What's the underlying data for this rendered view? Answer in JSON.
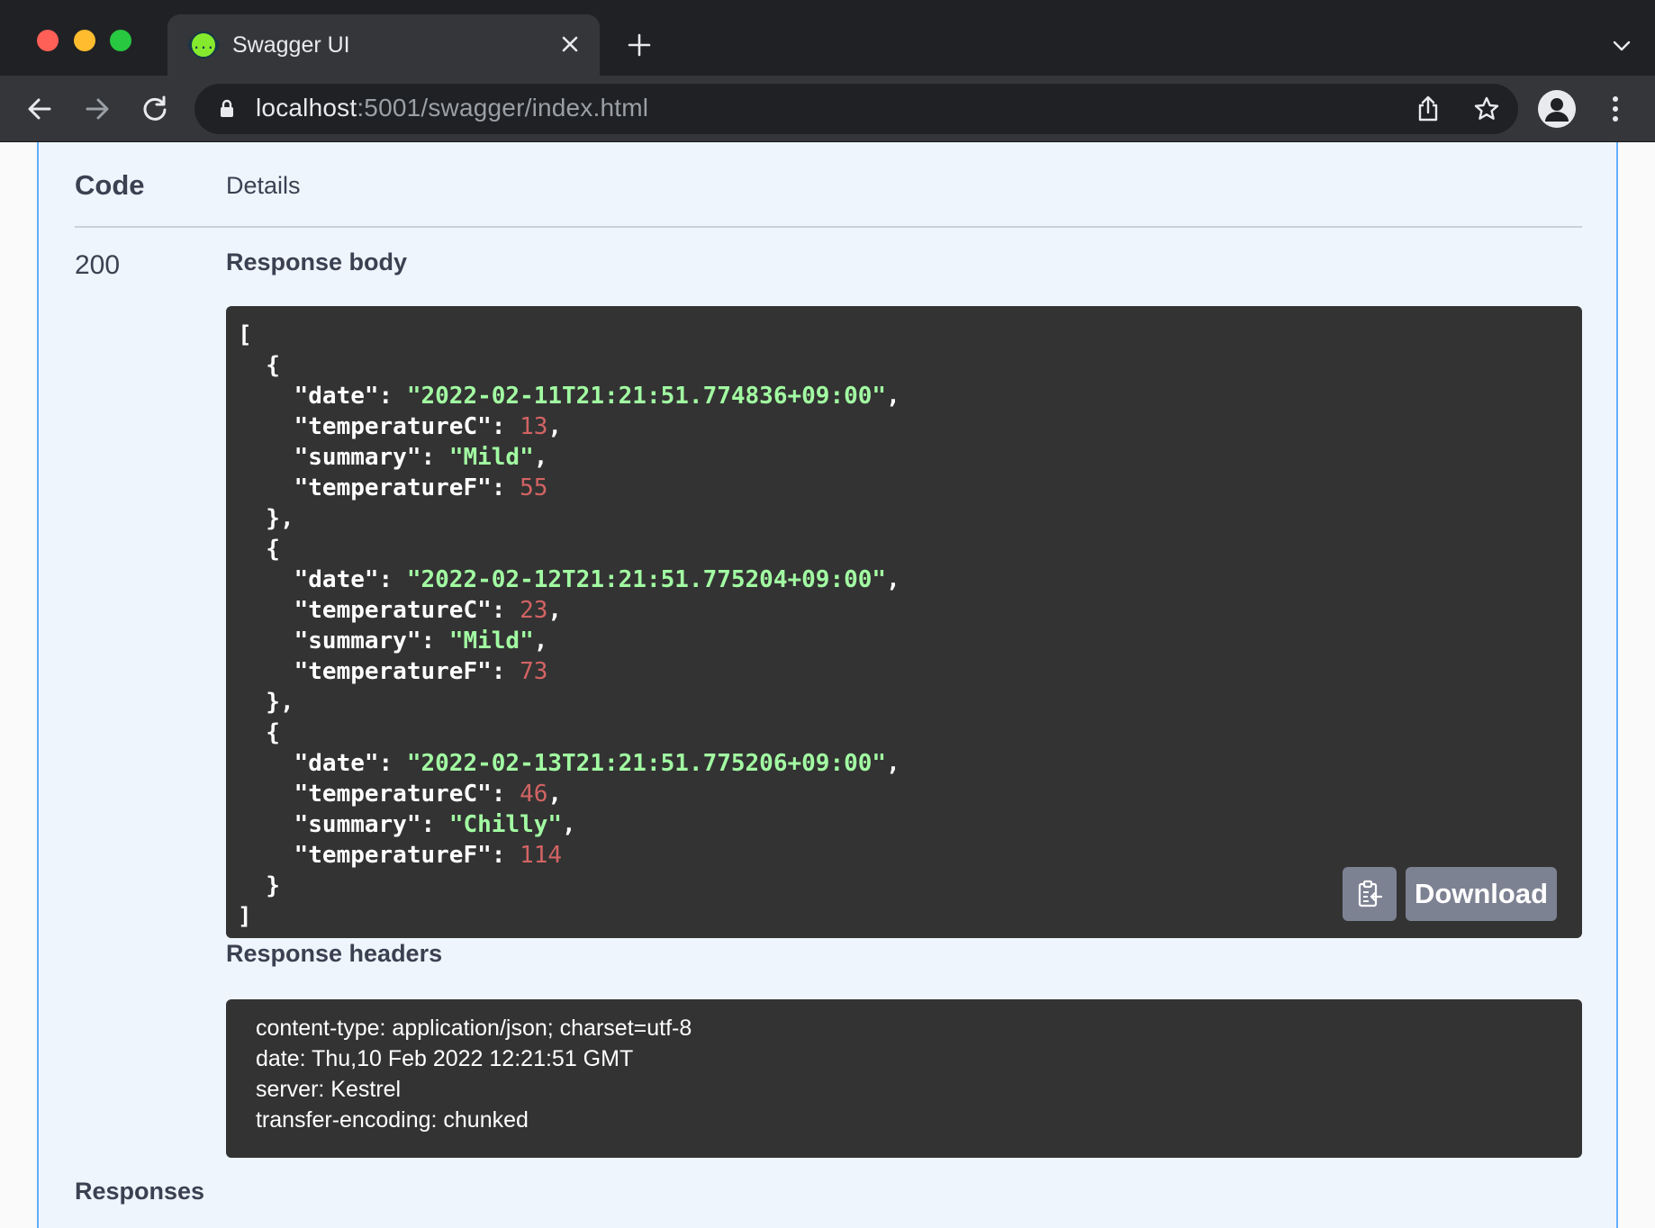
{
  "browser": {
    "tab": {
      "title": "Swagger UI",
      "favicon": "{...}",
      "favicon_icon": "swagger-favicon-icon"
    },
    "address": {
      "host": "localhost",
      "path": ":5001/swagger/index.html"
    },
    "colors": {
      "tabbar": "#202124",
      "toolbar": "#35363a"
    }
  },
  "responses_table": {
    "col_code": "Code",
    "col_details": "Details",
    "status_code": "200",
    "response_body_label": "Response body",
    "response_body_lines": [
      [
        {
          "t": "p",
          "v": "["
        }
      ],
      [
        {
          "t": "p",
          "v": "  {"
        }
      ],
      [
        {
          "t": "p",
          "v": "    \"date\": "
        },
        {
          "t": "s",
          "v": "\"2022-02-11T21:21:51.774836+09:00\""
        },
        {
          "t": "p",
          "v": ","
        }
      ],
      [
        {
          "t": "p",
          "v": "    \"temperatureC\": "
        },
        {
          "t": "n",
          "v": "13"
        },
        {
          "t": "p",
          "v": ","
        }
      ],
      [
        {
          "t": "p",
          "v": "    \"summary\": "
        },
        {
          "t": "s",
          "v": "\"Mild\""
        },
        {
          "t": "p",
          "v": ","
        }
      ],
      [
        {
          "t": "p",
          "v": "    \"temperatureF\": "
        },
        {
          "t": "n",
          "v": "55"
        }
      ],
      [
        {
          "t": "p",
          "v": "  },"
        }
      ],
      [
        {
          "t": "p",
          "v": "  {"
        }
      ],
      [
        {
          "t": "p",
          "v": "    \"date\": "
        },
        {
          "t": "s",
          "v": "\"2022-02-12T21:21:51.775204+09:00\""
        },
        {
          "t": "p",
          "v": ","
        }
      ],
      [
        {
          "t": "p",
          "v": "    \"temperatureC\": "
        },
        {
          "t": "n",
          "v": "23"
        },
        {
          "t": "p",
          "v": ","
        }
      ],
      [
        {
          "t": "p",
          "v": "    \"summary\": "
        },
        {
          "t": "s",
          "v": "\"Mild\""
        },
        {
          "t": "p",
          "v": ","
        }
      ],
      [
        {
          "t": "p",
          "v": "    \"temperatureF\": "
        },
        {
          "t": "n",
          "v": "73"
        }
      ],
      [
        {
          "t": "p",
          "v": "  },"
        }
      ],
      [
        {
          "t": "p",
          "v": "  {"
        }
      ],
      [
        {
          "t": "p",
          "v": "    \"date\": "
        },
        {
          "t": "s",
          "v": "\"2022-02-13T21:21:51.775206+09:00\""
        },
        {
          "t": "p",
          "v": ","
        }
      ],
      [
        {
          "t": "p",
          "v": "    \"temperatureC\": "
        },
        {
          "t": "n",
          "v": "46"
        },
        {
          "t": "p",
          "v": ","
        }
      ],
      [
        {
          "t": "p",
          "v": "    \"summary\": "
        },
        {
          "t": "s",
          "v": "\"Chilly\""
        },
        {
          "t": "p",
          "v": ","
        }
      ],
      [
        {
          "t": "p",
          "v": "    \"temperatureF\": "
        },
        {
          "t": "n",
          "v": "114"
        }
      ],
      [
        {
          "t": "p",
          "v": "  }"
        }
      ],
      [
        {
          "t": "p",
          "v": "]"
        }
      ]
    ],
    "copy_icon": "clipboard-copy-icon",
    "download_label": "Download",
    "response_headers_label": "Response headers",
    "response_headers": [
      " content-type: application/json; charset=utf-8 ",
      " date: Thu,10 Feb 2022 12:21:51 GMT ",
      " server: Kestrel ",
      " transfer-encoding: chunked "
    ],
    "responses_label": "Responses",
    "colors": {
      "panel_bg": "#eef5fc",
      "panel_border": "#61affe",
      "code_bg": "#333333",
      "json_string": "#a2fca2",
      "json_number": "#d36363",
      "button_bg": "#7d8293",
      "text": "#3b4151"
    }
  }
}
